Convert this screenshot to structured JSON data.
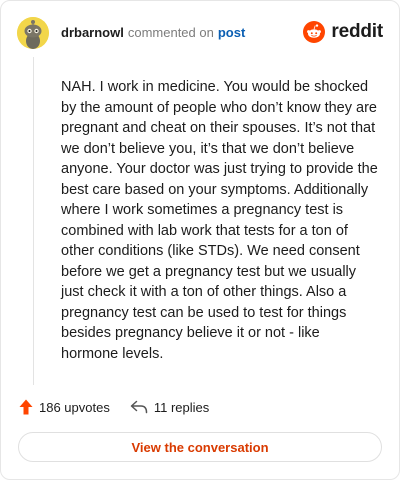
{
  "header": {
    "username": "drbarnowl",
    "action_text": "commented on",
    "post_link": "post"
  },
  "brand": {
    "name": "reddit",
    "icon": "reddit-logo-icon",
    "color": "#ff4500"
  },
  "comment": {
    "body": "NAH. I work in medicine. You would be shocked by the amount of people who don’t know they are pregnant and cheat on their spouses. It’s not that we don’t believe you, it’s that we don’t believe anyone. Your doctor was just trying to provide the best care based on your symptoms. Additionally where I work sometimes a pregnancy test is combined with lab work that tests for a ton of other conditions (like STDs). We need consent before we get a pregnancy test but we usually just check it with a ton of other things. Also a pregnancy test can be used to test for things besides pregnancy believe it or not - like hormone levels."
  },
  "actions": {
    "upvotes": "186 upvotes",
    "replies": "11 replies",
    "upvote_icon": "upvote-arrow-icon",
    "reply_icon": "reply-icon"
  },
  "footer": {
    "button_label": "View the conversation",
    "accent": "#d93a00"
  }
}
